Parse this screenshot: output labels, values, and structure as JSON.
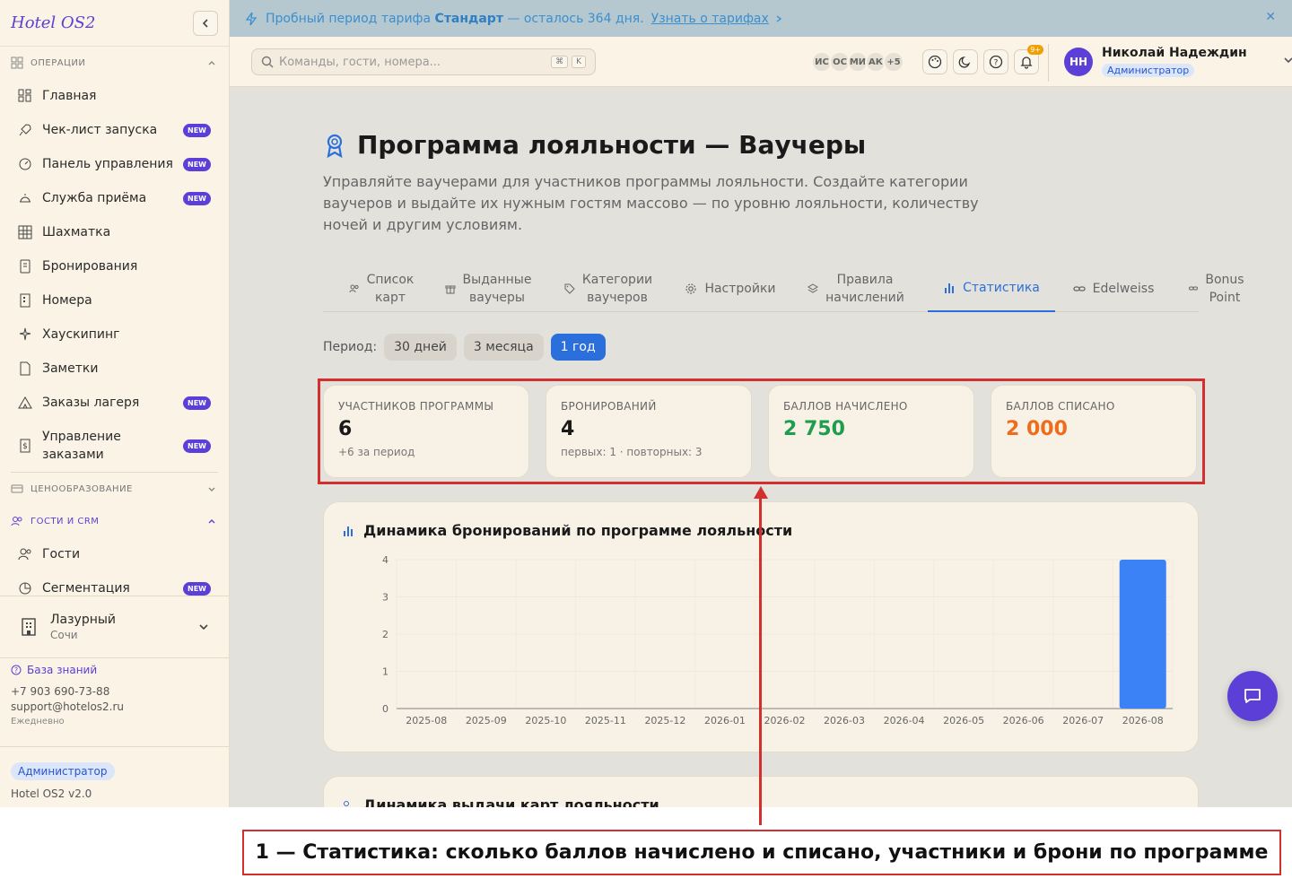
{
  "sidebar": {
    "logo": "Hotel OS2",
    "sections": {
      "operations": "Операции",
      "pricing": "Ценообразование",
      "guests_crm": "Гости и CRM"
    },
    "items": [
      {
        "label": "Главная",
        "new": false
      },
      {
        "label": "Чек-лист запуска",
        "new": true
      },
      {
        "label": "Панель управления",
        "new": true
      },
      {
        "label": "Служба приёма",
        "new": true
      },
      {
        "label": "Шахматка",
        "new": false
      },
      {
        "label": "Бронирования",
        "new": false
      },
      {
        "label": "Номера",
        "new": false
      },
      {
        "label": "Хаускипинг",
        "new": false
      },
      {
        "label": "Заметки",
        "new": false
      },
      {
        "label": "Заказы лагеря",
        "new": true
      },
      {
        "label": "Управление заказами",
        "new": true
      }
    ],
    "crm_items": [
      {
        "label": "Гости",
        "new": false
      },
      {
        "label": "Сегментация",
        "new": true
      }
    ],
    "new_badge": "NEW",
    "hotel": {
      "name": "Лазурный",
      "city": "Сочи"
    },
    "knowledge_base": "База знаний",
    "phone": "+7 903 690-73-88",
    "email": "support@hotelos2.ru",
    "schedule": "Ежедневно",
    "role": "Администратор",
    "version": "Hotel OS2 v2.0"
  },
  "banner": {
    "prefix": "Пробный период тарифа",
    "plan": "Стандарт",
    "suffix": "— осталось 364 дня.",
    "link": "Узнать о тарифах"
  },
  "header": {
    "search_placeholder": "Команды, гости, номера...",
    "kbd1": "⌘",
    "kbd2": "K",
    "avatars": [
      "ИС",
      "ОС",
      "МИ",
      "АК",
      "+5"
    ],
    "notif_count": "9+",
    "user_name": "Николай Надеждин",
    "user_role": "Администратор",
    "user_initials": "НН"
  },
  "page": {
    "title": "Программа лояльности — Ваучеры",
    "desc": "Управляйте ваучерами для участников программы лояльности. Создайте категории ваучеров и выдайте их нужным гостям массово — по уровню лояльности, количеству ночей и другим условиям.",
    "tabs": [
      {
        "l1": "Список",
        "l2": "карт"
      },
      {
        "l1": "Выданные",
        "l2": "ваучеры"
      },
      {
        "l1": "Категории",
        "l2": "ваучеров"
      },
      {
        "l1": "Настройки",
        "l2": ""
      },
      {
        "l1": "Правила",
        "l2": "начислений"
      },
      {
        "l1": "Статистика",
        "l2": ""
      },
      {
        "l1": "Edelweiss",
        "l2": ""
      },
      {
        "l1": "Bonus",
        "l2": "Point"
      }
    ],
    "period_label": "Период:",
    "periods": [
      "30 дней",
      "3 месяца",
      "1 год"
    ],
    "kpis": [
      {
        "title": "УЧАСТНИКОВ ПРОГРАММЫ",
        "value": "6",
        "sub": "+6 за период",
        "color": "#1a1a1a"
      },
      {
        "title": "БРОНИРОВАНИЙ",
        "value": "4",
        "sub": "первых: 1 · повторных: 3",
        "color": "#1a1a1a"
      },
      {
        "title": "БАЛЛОВ НАЧИСЛЕНО",
        "value": "2 750",
        "sub": "",
        "color": "#1f9d4f"
      },
      {
        "title": "БАЛЛОВ СПИСАНО",
        "value": "2 000",
        "sub": "",
        "color": "#ef6c1a"
      }
    ],
    "chart_title": "Динамика бронирований по программе лояльности",
    "card2_title": "Динамика выдачи карт лояльности"
  },
  "chart_data": {
    "type": "bar",
    "title": "Динамика бронирований по программе лояльности",
    "categories": [
      "2025-08",
      "2025-09",
      "2025-10",
      "2025-11",
      "2025-12",
      "2026-01",
      "2026-02",
      "2026-03",
      "2026-04",
      "2026-05",
      "2026-06",
      "2026-07",
      "2026-08"
    ],
    "values": [
      0,
      0,
      0,
      0,
      0,
      0,
      0,
      0,
      0,
      0,
      0,
      0,
      4
    ],
    "yticks": [
      0,
      1,
      2,
      3,
      4
    ],
    "ylim": [
      0,
      4
    ],
    "bar_color": "#3b82f6"
  },
  "annotation": {
    "caption": "1 — Статистика: сколько баллов начислено и списано, участники и брони по программе"
  }
}
